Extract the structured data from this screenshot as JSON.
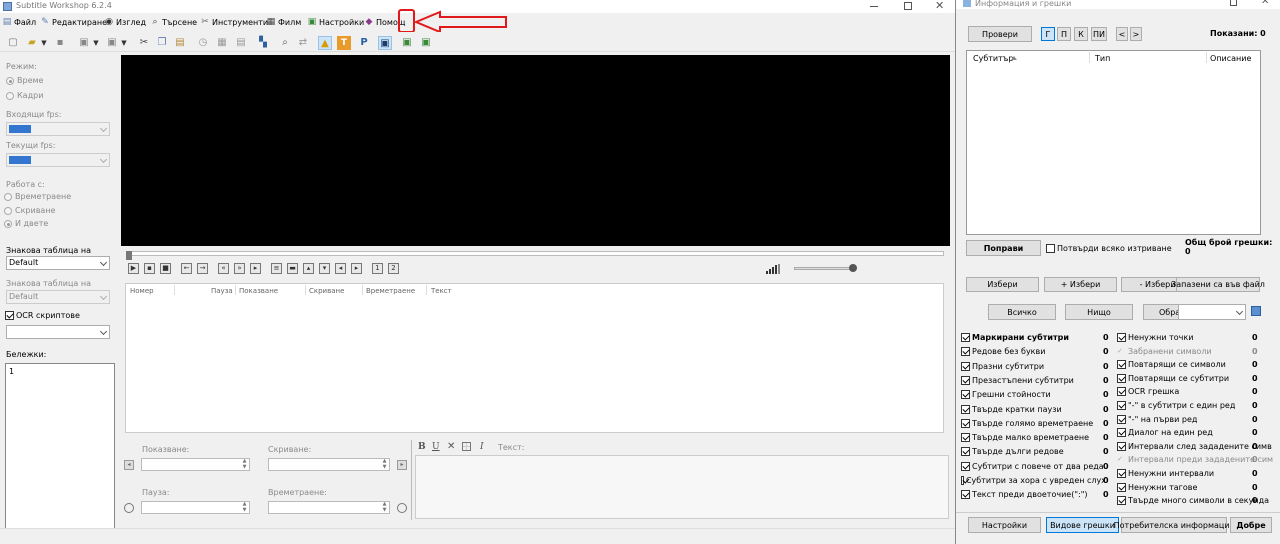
{
  "main_window": {
    "title": "Subtitle Workshop 6.2.4",
    "menu": [
      {
        "label": "Файл",
        "icon": "file-icon"
      },
      {
        "label": "Редактиране",
        "icon": "edit-icon"
      },
      {
        "label": "Изглед",
        "icon": "eye-icon"
      },
      {
        "label": "Търсене",
        "icon": "search-icon"
      },
      {
        "label": "Инструменти",
        "icon": "tools-icon"
      },
      {
        "label": "Филм",
        "icon": "film-icon"
      },
      {
        "label": "Настройки",
        "icon": "settings-icon"
      },
      {
        "label": "Помощ",
        "icon": "help-icon"
      }
    ],
    "left_panel": {
      "mode_label": "Режим:",
      "mode_options": [
        "Време",
        "Кадри"
      ],
      "input_fps_label": "Входящи fps:",
      "current_fps_label": "Текущи fps:",
      "work_with_label": "Работа с:",
      "work_with_options": [
        "Времетраене",
        "Скриване",
        "И двете"
      ],
      "orig_charset_label": "Знакова таблица на оригинала:",
      "orig_charset_value": "Default",
      "trans_charset_label": "Знакова таблица на превода:",
      "trans_charset_value": "Default",
      "ocr_label": "OCR скриптове",
      "notes_label": "Бележки:",
      "notes_value": "1"
    },
    "subtitle_columns": [
      "Номер",
      "Пауза",
      "Показване",
      "Скриване",
      "Времетраене",
      "Текст"
    ],
    "editor": {
      "show_label": "Показване:",
      "hide_label": "Скриване:",
      "pause_label": "Пауза:",
      "duration_label": "Времетраене:",
      "text_label": "Текст:",
      "format_bold": "B",
      "format_underline": "U",
      "format_italic": "I"
    }
  },
  "info_window": {
    "title": "Информация и грешки",
    "check_button": "Провери",
    "mode_buttons": [
      "Г",
      "П",
      "К",
      "ПИ"
    ],
    "prev_button": "<",
    "next_button": ">",
    "shown_label": "Показани: 0",
    "columns": [
      "Субтитър",
      "Тип",
      "Описание"
    ],
    "fix_button": "Поправи",
    "confirm_delete_label": "Потвърди всяко изтриване",
    "total_errors_label": "Общ брой грешки: 0",
    "select_button": "Избери",
    "add_select_button": "+ Избери",
    "remove_select_button": "- Избери",
    "save_file_button": "Запазени са във файл",
    "all_button": "Всичко",
    "none_button": "Нищо",
    "invert_button": "Обратно",
    "errors_left": [
      {
        "label": "Маркирани субтитри",
        "count": "0",
        "bold": true
      },
      {
        "label": "Редове без букви",
        "count": "0"
      },
      {
        "label": "Празни субтитри",
        "count": "0"
      },
      {
        "label": "Презастъпени субтитри",
        "count": "0"
      },
      {
        "label": "Грешни стойности",
        "count": "0"
      },
      {
        "label": "Твърде кратки паузи",
        "count": "0"
      },
      {
        "label": "Твърде голямо времетраене",
        "count": "0"
      },
      {
        "label": "Твърде малко времетраене",
        "count": "0"
      },
      {
        "label": "Твърде дълги редове",
        "count": "0"
      },
      {
        "label": "Субтитри с повече от два реда",
        "count": "0"
      },
      {
        "label": "Субтитри за хора с увреден слух",
        "count": "0"
      },
      {
        "label": "Текст преди двоеточие(\":\")",
        "count": "0"
      }
    ],
    "errors_right": [
      {
        "label": "Ненужни точки",
        "count": "0",
        "checked": true
      },
      {
        "label": "Забранени символи",
        "count": "0",
        "checked": false
      },
      {
        "label": "Повтарящи се символи",
        "count": "0",
        "checked": true
      },
      {
        "label": "Повтарящи се субтитри",
        "count": "0",
        "checked": true
      },
      {
        "label": "OCR грешка",
        "count": "0",
        "checked": true
      },
      {
        "label": "\"-\" в субтитри с един ред",
        "count": "0",
        "checked": true
      },
      {
        "label": "\"-\" на първи ред",
        "count": "0",
        "checked": true
      },
      {
        "label": "Диалог на един ред",
        "count": "0",
        "checked": true
      },
      {
        "label": "Интервали след зададените симв",
        "count": "0",
        "checked": true
      },
      {
        "label": "Интервали преди зададените сим",
        "count": "0",
        "checked": false
      },
      {
        "label": "Ненужни интервали",
        "count": "0",
        "checked": true
      },
      {
        "label": "Ненужни тагове",
        "count": "0",
        "checked": true
      },
      {
        "label": "Твърде много символи в секунда",
        "count": "0",
        "checked": true
      }
    ],
    "settings_button": "Настройки",
    "view_errors_button": "Видове грешки",
    "user_info_button": "Потребителска информация",
    "ok_button": "Добре"
  },
  "colors": {
    "accent": "#3376d0",
    "annotation_red": "#e01a1a",
    "video_bg": "#000000",
    "title_bar": "#ffffff",
    "pressed_button": "#cce4f7"
  }
}
